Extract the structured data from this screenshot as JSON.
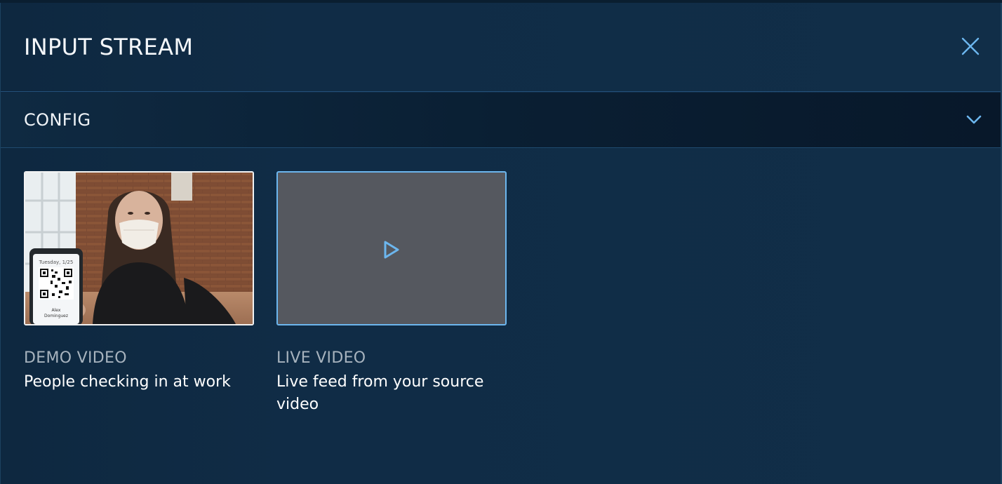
{
  "header": {
    "title": "INPUT STREAM",
    "close_icon": "close-icon"
  },
  "config": {
    "label": "CONFIG",
    "chevron_icon": "chevron-down-icon"
  },
  "options": [
    {
      "kicker": "DEMO VIDEO",
      "description": "People checking in at work"
    },
    {
      "kicker": "LIVE VIDEO",
      "description": "Live feed from your source video",
      "play_icon": "play-icon"
    }
  ],
  "colors": {
    "background": "#0f2a42",
    "accent": "#6cb6ee",
    "kicker_text": "#a7b3be",
    "live_thumb_bg": "#55585f"
  }
}
